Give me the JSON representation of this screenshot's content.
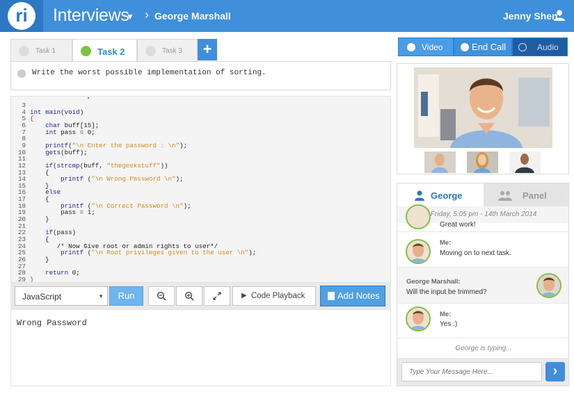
{
  "header": {
    "logo_letter": "ri",
    "app_title": "Interviews",
    "breadcrumb": "George Marshall",
    "user_name": "Jenny Shen"
  },
  "tasks": {
    "tabs": [
      {
        "label": "Task 1",
        "active": false
      },
      {
        "label": "Task 2",
        "active": true
      },
      {
        "label": "Task 3",
        "active": false
      }
    ],
    "add_label": "+",
    "description": "Write the worst possible implementation of sorting."
  },
  "editor": {
    "lines": [
      {
        "n": "3",
        "code": ""
      },
      {
        "n": "4",
        "code": "int main(void)"
      },
      {
        "n": "5",
        "code": "{"
      },
      {
        "n": "6",
        "code": "    char buff[15];"
      },
      {
        "n": "7",
        "code": "    int pass = 0;"
      },
      {
        "n": "8",
        "code": ""
      },
      {
        "n": "9",
        "code": "    printf(\"\\n Enter the password : \\n\");"
      },
      {
        "n": "10",
        "code": "    gets(buff);"
      },
      {
        "n": "11",
        "code": ""
      },
      {
        "n": "12",
        "code": "    if(strcmp(buff, \"thegeekstuff\"))"
      },
      {
        "n": "13",
        "code": "    {"
      },
      {
        "n": "14",
        "code": "        printf (\"\\n Wrong Password \\n\");"
      },
      {
        "n": "15",
        "code": "    }"
      },
      {
        "n": "16",
        "code": "    else"
      },
      {
        "n": "17",
        "code": "    {"
      },
      {
        "n": "18",
        "code": "        printf (\"\\n Correct Password \\n\");"
      },
      {
        "n": "19",
        "code": "        pass = 1;"
      },
      {
        "n": "20",
        "code": "    }"
      },
      {
        "n": "21",
        "code": ""
      },
      {
        "n": "22",
        "code": "    if(pass)"
      },
      {
        "n": "23",
        "code": "    {"
      },
      {
        "n": "24",
        "code": "       /* Now Give root or admin rights to user*/"
      },
      {
        "n": "25",
        "code": "        printf (\"\\n Root privileges given to the user \\n\");"
      },
      {
        "n": "26",
        "code": "    }"
      },
      {
        "n": "27",
        "code": ""
      },
      {
        "n": "28",
        "code": "    return 0;"
      },
      {
        "n": "29",
        "code": "}"
      }
    ]
  },
  "toolbar": {
    "language": "JavaScript",
    "run_label": "Run",
    "zoom_out_icon": "zoom-out-icon",
    "zoom_in_icon": "zoom-in-icon",
    "expand_icon": "expand-icon",
    "playback_label": "Code Playback",
    "notes_label": "Add Notes"
  },
  "output": {
    "text": "Wrong Password"
  },
  "call": {
    "video_label": "Video",
    "end_label": "End Call",
    "audio_label": "Audio"
  },
  "chat": {
    "tab_active": "George",
    "tab_inactive": "Panel",
    "timestamp": "Friday, 5:05 pm - 14th March 2014",
    "messages": [
      {
        "sender": "",
        "text": "Great work!"
      },
      {
        "sender": "Me:",
        "text": "Moving on to next task."
      },
      {
        "sender": "George Marshall:",
        "text": "Will the input be trimmed?"
      },
      {
        "sender": "Me:",
        "text": "Yes :)"
      }
    ],
    "typing": "George is typing...",
    "input_placeholder": "Type Your Message Here...",
    "send_label": "›"
  },
  "colors": {
    "header": "#3f8fdb",
    "accent_green": "#7cc242",
    "button_blue": "#4fa1e3"
  }
}
